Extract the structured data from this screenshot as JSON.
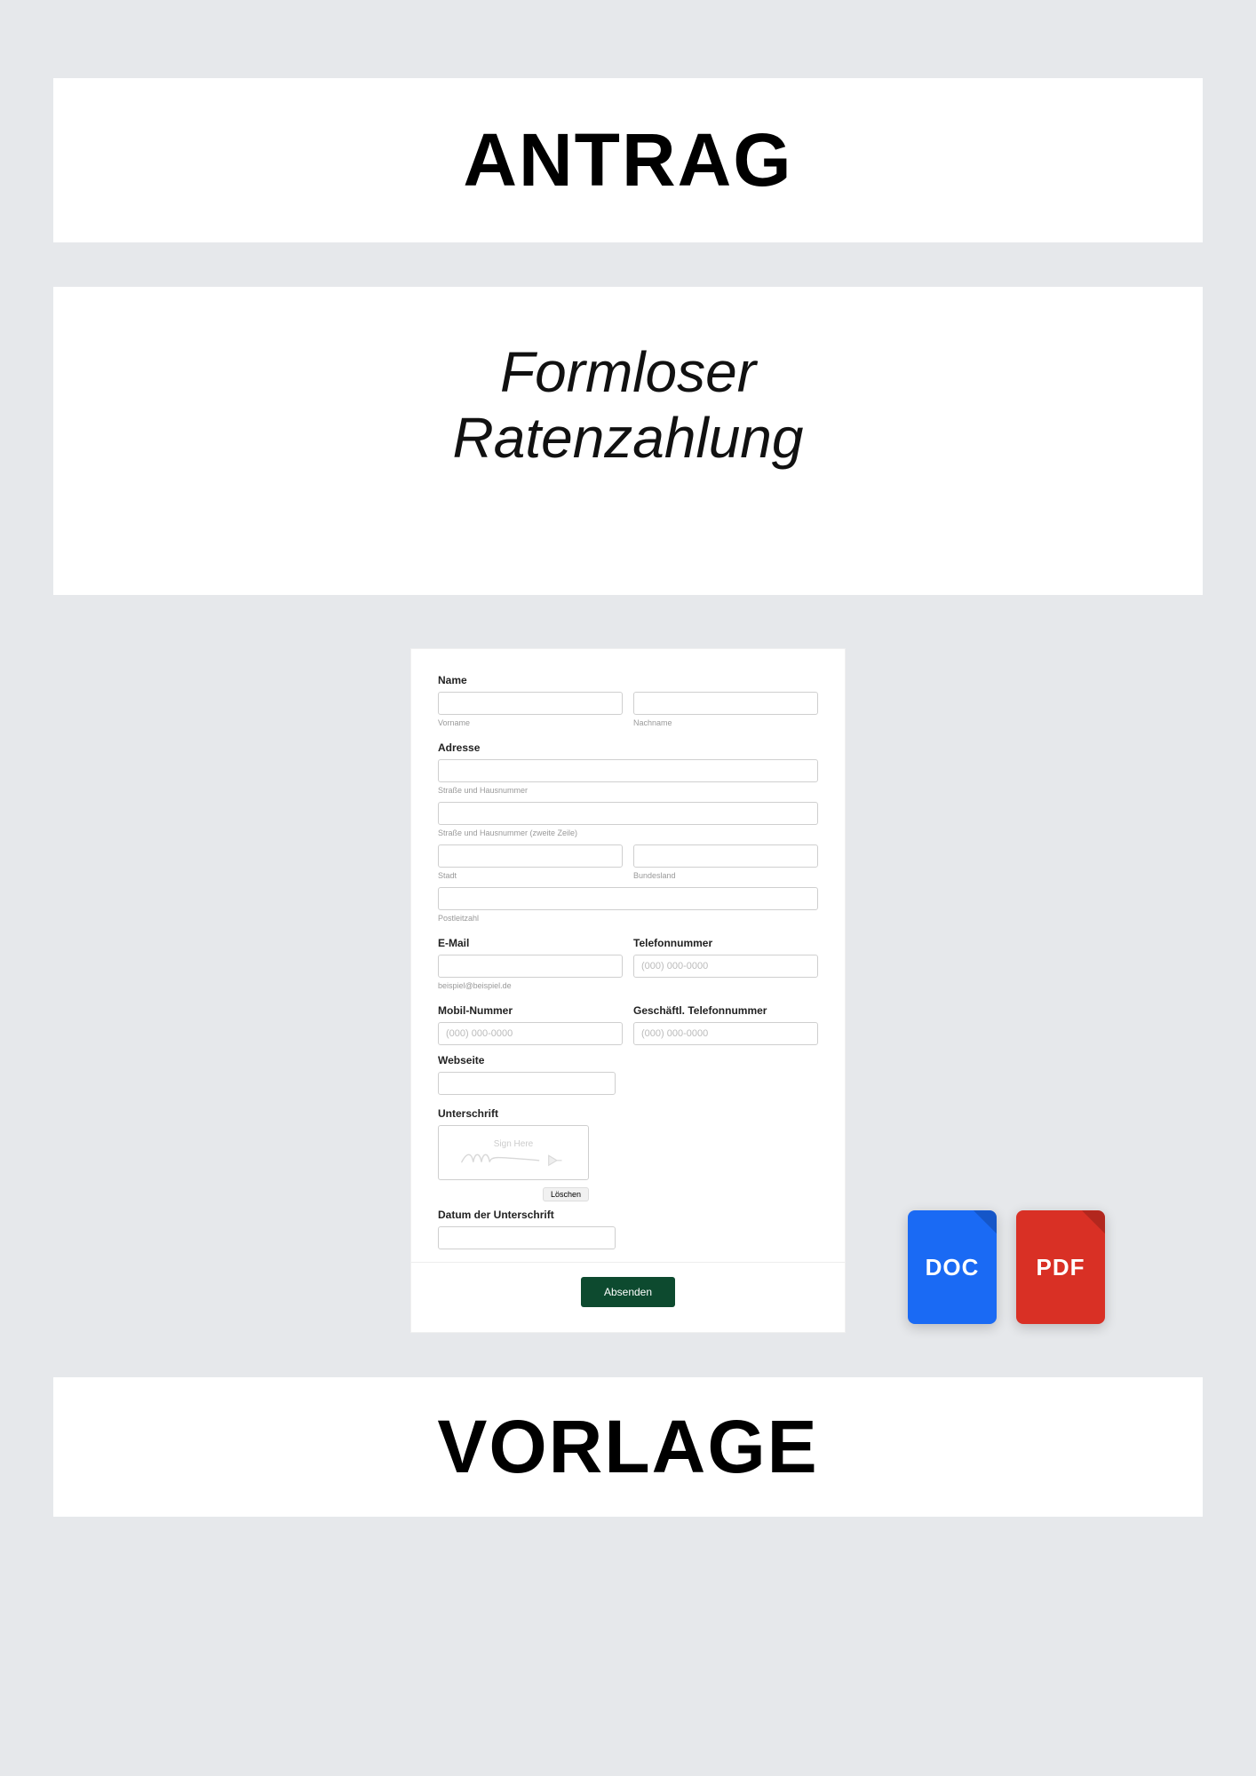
{
  "header": {
    "title": "ANTRAG"
  },
  "subtitle": {
    "line1": "Formloser",
    "line2": "Ratenzahlung"
  },
  "form": {
    "name": {
      "label": "Name",
      "firstHint": "Vorname",
      "lastHint": "Nachname"
    },
    "address": {
      "label": "Adresse",
      "streetHint": "Straße und Hausnummer",
      "street2Hint": "Straße und Hausnummer (zweite Zeile)",
      "cityHint": "Stadt",
      "stateHint": "Bundesland",
      "zipHint": "Postleitzahl"
    },
    "email": {
      "label": "E-Mail",
      "hint": "beispiel@beispiel.de"
    },
    "phone": {
      "label": "Telefonnummer",
      "placeholder": "(000) 000-0000"
    },
    "mobile": {
      "label": "Mobil-Nummer",
      "placeholder": "(000) 000-0000"
    },
    "workphone": {
      "label": "Geschäftl. Telefonnummer",
      "placeholder": "(000) 000-0000"
    },
    "website": {
      "label": "Webseite"
    },
    "signature": {
      "label": "Unterschrift",
      "signHere": "Sign Here",
      "clear": "Löschen"
    },
    "sigdate": {
      "label": "Datum der Unterschrift"
    },
    "submit": "Absenden"
  },
  "files": {
    "doc": "DOC",
    "pdf": "PDF"
  },
  "footer": {
    "title": "VORLAGE"
  }
}
